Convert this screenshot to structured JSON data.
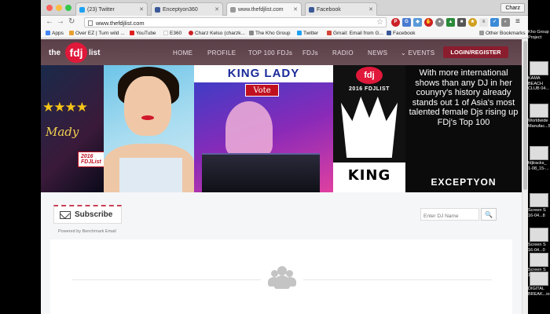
{
  "browser": {
    "tabs": [
      {
        "label": "(23) Twitter",
        "color": "#1da1f2",
        "active": false
      },
      {
        "label": "Enceptyon360",
        "color": "#3b5998",
        "active": false
      },
      {
        "label": "www.thefdjlist.com",
        "color": "#999999",
        "active": true
      },
      {
        "label": "Facebook",
        "color": "#3b5998",
        "active": false
      }
    ],
    "user_button": "Charz",
    "url": "www.thefdjlist.com",
    "bookmarks": [
      {
        "label": "Apps",
        "color": "#4285f4"
      },
      {
        "label": "Over EZ | Turn wild ...",
        "color": "#e8a030"
      },
      {
        "label": "YouTube",
        "color": "#e02020"
      },
      {
        "label": "E360",
        "color": "#ffffff"
      },
      {
        "label": "Charz Kelso (charzk...",
        "color": "#cb2027"
      },
      {
        "label": "The Kho Group",
        "color": "#888888"
      },
      {
        "label": "Twitter",
        "color": "#1da1f2"
      },
      {
        "label": "Gmail: Email from G...",
        "color": "#d44638"
      },
      {
        "label": "Facebook",
        "color": "#3b5998"
      }
    ],
    "other_bookmarks": "Other Bookmarks"
  },
  "site": {
    "logo": {
      "pre": "the",
      "mid": "fdj",
      "post": "list"
    },
    "nav": [
      "HOME",
      "PROFILE",
      "TOP 100 FDJs",
      "FDJs",
      "RADIO",
      "NEWS",
      "EVENTS"
    ],
    "login_label": "LOGIN/REGISTER",
    "accent": "#8a1e2e",
    "brand_red": "#e0183a"
  },
  "banner": {
    "mady": "Mady",
    "fdj_tag": "2016 FDJList",
    "king_lady": "KING LADY",
    "vote": "Vote",
    "fdj_logo": "fdj",
    "year_label": "2016 FDJLIST",
    "king_text": "KING",
    "promo_text": "With more international shows than any DJ in her counyry's history already stands out 1 of Asia's most talented female Djs rising up FDj's Top 100",
    "brand": "EXCEPTYON"
  },
  "subscribe": {
    "label": "Subscribe",
    "powered": "Powered by Benchmark Email"
  },
  "search": {
    "placeholder": "Enter DJ Name"
  },
  "desktop": {
    "items": [
      {
        "label": "Kho Group Project",
        "type": "folder"
      },
      {
        "label": "KAMA BEACH CLUB 04...",
        "type": "file"
      },
      {
        "label": "Worldwide Manufac...5",
        "type": "file"
      },
      {
        "label": "fdjtracks_ 1-08_15-...",
        "type": "file"
      },
      {
        "label": "Screen S 16-04...8",
        "type": "file"
      },
      {
        "label": "Screen S 16-04...0",
        "type": "file"
      },
      {
        "label": "Screen S 16-04...0",
        "type": "file"
      },
      {
        "label": "DIGITAL BREAK...io",
        "type": "file"
      }
    ]
  }
}
